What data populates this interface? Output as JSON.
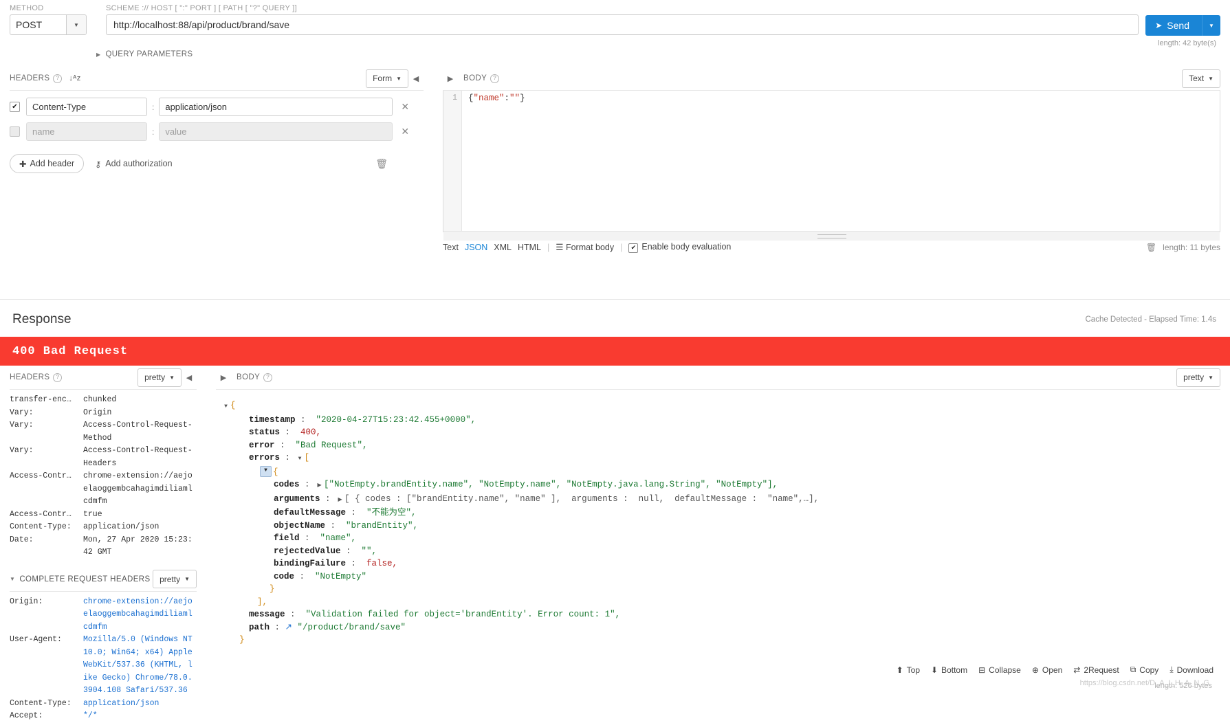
{
  "request": {
    "method_label": "METHOD",
    "method_value": "POST",
    "url_label": "SCHEME :// HOST [ \":\" PORT ] [ PATH [ \"?\" QUERY ]]",
    "url_value": "http://localhost:88/api/product/brand/save",
    "send_label": "Send",
    "url_length": "length: 42 byte(s)",
    "query_parameters_label": "QUERY PARAMETERS"
  },
  "headers_section": {
    "title": "HEADERS",
    "form_label": "Form",
    "rows": [
      {
        "checked": true,
        "name": "Content-Type",
        "value": "application/json"
      },
      {
        "checked": false,
        "name": "",
        "value": "",
        "name_placeholder": "name",
        "value_placeholder": "value"
      }
    ],
    "add_header_label": "Add header",
    "add_authorization_label": "Add authorization"
  },
  "body_section": {
    "title": "BODY",
    "mode_label": "Text",
    "line_number": "1",
    "code": "{\"name\":\"\"}",
    "code_parts": {
      "open": "{",
      "key": "\"name\"",
      "colon": ":",
      "val": "\"\"",
      "close": "}"
    },
    "toolbar": {
      "text": "Text",
      "json": "JSON",
      "xml": "XML",
      "html": "HTML",
      "format_body": "Format body",
      "enable_body_evaluation": "Enable body evaluation",
      "length": "length: 11 bytes"
    }
  },
  "response": {
    "title": "Response",
    "meta": "Cache Detected - Elapsed Time: 1.4s",
    "status": "400 Bad Request",
    "status_color": "#f93b30",
    "headers_title": "HEADERS",
    "headers_pretty": "pretty",
    "headers": [
      {
        "key": "transfer-enc…",
        "value": "chunked"
      },
      {
        "key": "Vary:",
        "value": "Origin"
      },
      {
        "key": "Vary:",
        "value": "Access-Control-Request-Method"
      },
      {
        "key": "Vary:",
        "value": "Access-Control-Request-Headers"
      },
      {
        "key": "Access-Contr…",
        "value": "chrome-extension://aejoelaoggembcahagimdiliamlcdmfm"
      },
      {
        "key": "Access-Contr…",
        "value": "true"
      },
      {
        "key": "Content-Type:",
        "value": "application/json"
      },
      {
        "key": "Date:",
        "value": "Mon, 27 Apr 2020 15:23:42 GMT"
      }
    ],
    "complete_request_headers_title": "COMPLETE REQUEST HEADERS",
    "complete_request_headers_pretty": "pretty",
    "request_headers": [
      {
        "key": "Origin:",
        "value": "chrome-extension://aejoelaoggembcahagimdiliamlcdmfm"
      },
      {
        "key": "User-Agent:",
        "value": "Mozilla/5.0 (Windows NT 10.0; Win64; x64) AppleWebKit/537.36 (KHTML, like Gecko) Chrome/78.0.3904.108 Safari/537.36"
      },
      {
        "key": "Content-Type:",
        "value": "application/json"
      },
      {
        "key": "Accept:",
        "value": "*/*"
      }
    ],
    "body_title": "BODY",
    "body_pretty": "pretty",
    "body_length": "length: 526 bytes",
    "json": {
      "open_brace": "{",
      "timestamp_key": "timestamp",
      "timestamp_value": "\"2020-04-27T15:23:42.455+0000\",",
      "status_key": "status",
      "status_value": "400,",
      "error_key": "error",
      "error_value": "\"Bad Request\",",
      "errors_key": "errors",
      "errors_open": "[",
      "inner_open": "{",
      "codes_key": "codes",
      "codes_value": "[\"NotEmpty.brandEntity.name\", \"NotEmpty.name\", \"NotEmpty.java.lang.String\", \"NotEmpty\"],",
      "arguments_key": "arguments",
      "arguments_value": "[ { codes : [\"brandEntity.name\", \"name\" ],  arguments :  null,  defaultMessage :  \"name\",…],",
      "default_message_key": "defaultMessage",
      "default_message_value": "\"不能为空\",",
      "object_name_key": "objectName",
      "object_name_value": "\"brandEntity\",",
      "field_key": "field",
      "field_value": "\"name\",",
      "rejected_value_key": "rejectedValue",
      "rejected_value_value": "\"\",",
      "binding_failure_key": "bindingFailure",
      "binding_failure_value": "false,",
      "code_key": "code",
      "code_value": "\"NotEmpty\"",
      "inner_close": "}",
      "errors_close": "],",
      "message_key": "message",
      "message_value": "\"Validation failed for object='brandEntity'. Error count: 1\",",
      "path_key": "path",
      "path_value": "\"/product/brand/save\"",
      "close_brace": "}"
    },
    "action_bar": [
      {
        "icon": "arrow-up-icon",
        "label": "Top"
      },
      {
        "icon": "arrow-down-icon",
        "label": "Bottom"
      },
      {
        "icon": "collapse-icon",
        "label": "Collapse"
      },
      {
        "icon": "open-icon",
        "label": "Open"
      },
      {
        "icon": "request-icon",
        "label": "2Request"
      },
      {
        "icon": "copy-icon",
        "label": "Copy"
      },
      {
        "icon": "download-icon",
        "label": "Download"
      }
    ],
    "watermark": "https://blog.csdn.net/D_A_I_H_A_N_G"
  }
}
